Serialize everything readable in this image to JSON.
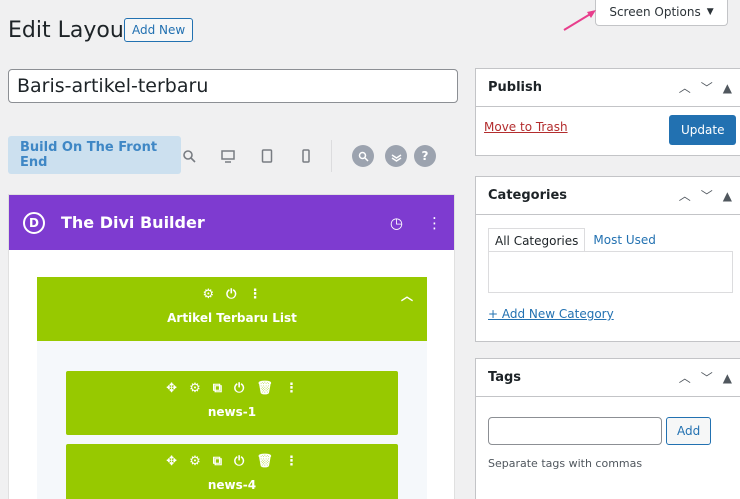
{
  "screen_options": {
    "label": "Screen Options",
    "caret": "▼"
  },
  "header": {
    "title": "Edit Layout",
    "add_new": "Add New"
  },
  "post_title": {
    "value": "Baris-artikel-terbaru"
  },
  "toolbar": {
    "frontend_label": "Build On The Front End"
  },
  "divi": {
    "logo": "D",
    "title": "The Divi Builder",
    "section": {
      "label": "Artikel Terbaru List"
    },
    "modules": [
      {
        "label": "news-1"
      },
      {
        "label": "news-4"
      }
    ]
  },
  "publish": {
    "title": "Publish",
    "trash": "Move to Trash",
    "update": "Update"
  },
  "categories": {
    "title": "Categories",
    "tab_all": "All Categories",
    "tab_most_used": "Most Used",
    "add_new": "+ Add New Category"
  },
  "tags": {
    "title": "Tags",
    "add": "Add",
    "help": "Separate tags with commas"
  },
  "colors": {
    "divi_purple": "#7e3bd0",
    "module_green": "#97c900",
    "wp_blue": "#2271b1"
  }
}
